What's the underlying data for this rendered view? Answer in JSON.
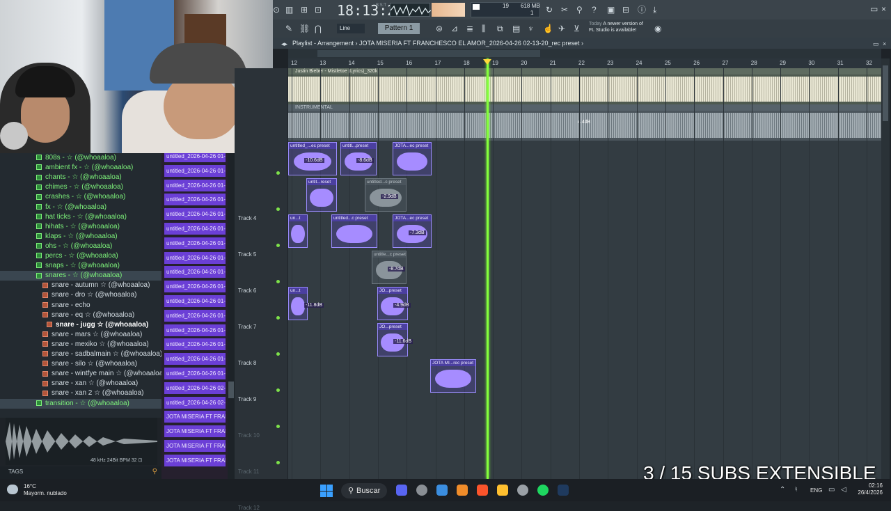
{
  "webcam": {
    "label": "webcam overlay"
  },
  "browser": {
    "items": [
      {
        "label": "808s - ☆ (@whoaaloa)",
        "type": "folder"
      },
      {
        "label": "ambient fx - ☆ (@whoaaloa)",
        "type": "folder"
      },
      {
        "label": "chants - ☆ (@whoaaloa)",
        "type": "folder"
      },
      {
        "label": "chimes - ☆ (@whoaaloa)",
        "type": "folder"
      },
      {
        "label": "crashes - ☆ (@whoaaloa)",
        "type": "folder"
      },
      {
        "label": "fx - ☆ (@whoaaloa)",
        "type": "folder"
      },
      {
        "label": "hat ticks - ☆ (@whoaaloa)",
        "type": "folder"
      },
      {
        "label": "hihats - ☆ (@whoaaloa)",
        "type": "folder"
      },
      {
        "label": "klaps - ☆ (@whoaaloa)",
        "type": "folder"
      },
      {
        "label": "ohs - ☆ (@whoaaloa)",
        "type": "folder"
      },
      {
        "label": "percs - ☆ (@whoaaloa)",
        "type": "folder"
      },
      {
        "label": "snaps - ☆ (@whoaaloa)",
        "type": "folder"
      },
      {
        "label": "snares - ☆ (@whoaaloa)",
        "type": "folder",
        "selected": true
      },
      {
        "label": "snare - autumn ☆ (@whoaaloa)",
        "type": "file"
      },
      {
        "label": "snare - dro ☆ (@whoaaloa)",
        "type": "file"
      },
      {
        "label": "snare - echo",
        "type": "file"
      },
      {
        "label": "snare - eq ☆ (@whoaaloa)",
        "type": "file"
      },
      {
        "label": "snare - jugg ☆ (@whoaaloa)",
        "type": "file",
        "highlight": true
      },
      {
        "label": "snare - mars ☆ (@whoaaloa)",
        "type": "file"
      },
      {
        "label": "snare - mexiko ☆ (@whoaaloa)",
        "type": "file"
      },
      {
        "label": "snare - sadbalmain ☆ (@whoaaloa)",
        "type": "file"
      },
      {
        "label": "snare - silo ☆ (@whoaaloa)",
        "type": "file"
      },
      {
        "label": "snare - wintfye main ☆ (@whoaaloa)",
        "type": "file"
      },
      {
        "label": "snare - xan ☆ (@whoaaloa)",
        "type": "file"
      },
      {
        "label": "snare - xan 2 ☆ (@whoaaloa)",
        "type": "file"
      },
      {
        "label": "transition - ☆ (@whoaaloa)",
        "type": "folder",
        "selected": true
      }
    ],
    "preview_info": "48 kHz 24Bit BPM 32 ⊡",
    "tags_label": "TAGS"
  },
  "patterns": [
    "untitled_2026-04-26 01-...",
    "untitled_2026-04-26 01-...",
    "untitled_2026-04-26 01-...",
    "untitled_2026-04-26 01-...",
    "untitled_2026-04-26 01-...",
    "untitled_2026-04-26 01-...",
    "untitled_2026-04-26 01-...",
    "untitled_2026-04-26 01-...",
    "untitled_2026-04-26 01-...",
    "untitled_2026-04-26 01-...",
    "untitled_2026-04-26 01-...",
    "untitled_2026-04-26 01-...",
    "untitled_2026-04-26 01-...",
    "untitled_2026-04-26 01-...",
    "untitled_2026-04-26 01-...",
    "untitled_2026-04-26 01-...",
    "untitled_2026-04-26 02-...",
    "untitled_2026-04-26 02-...",
    "JOTA MISERIA FT FRANCH...",
    "JOTA MISERIA FT FRANCH...",
    "JOTA MISERIA FT FRANCH...",
    "JOTA MISERIA FT FRANCH..."
  ],
  "toolbar": {
    "time": "18:13:21",
    "time_sub": "B:S:T",
    "cpu_a": "19",
    "cpu_b": "618 MB",
    "cpu_c": "1",
    "snap": "Line",
    "pattern": "Pattern 1",
    "notice_date": "Today",
    "notice_text": "A newer version of",
    "notice_text2": "FL Studio is available!"
  },
  "playlist": {
    "title": "Playlist - Arrangement  ›  JOTA MISERIA FT FRANCHESCO EL AMOR_2026-04-26 02-13-20_rec preset  ›",
    "ruler": [
      "12",
      "13",
      "14",
      "15",
      "16",
      "17",
      "18",
      "19",
      "20",
      "21",
      "22",
      "23",
      "24",
      "25",
      "26",
      "27",
      "28",
      "29",
      "30",
      "31",
      "32"
    ],
    "audio1_label": "Justin Bieber - Mistletoe (Lyrics)_320k",
    "audio2_label": "INSTRUMENTAL",
    "audio2_db": "4.4dB",
    "tracks": [
      {
        "name": "",
        "dim": false
      },
      {
        "name": "Track 4",
        "dim": false
      },
      {
        "name": "Track 5",
        "dim": false
      },
      {
        "name": "Track 6",
        "dim": false
      },
      {
        "name": "Track 7",
        "dim": false
      },
      {
        "name": "Track 8",
        "dim": false
      },
      {
        "name": "Track 9",
        "dim": false
      },
      {
        "name": "Track 10",
        "dim": true
      },
      {
        "name": "Track 11",
        "dim": true
      },
      {
        "name": "Track 12",
        "dim": true
      }
    ],
    "clips": [
      {
        "row": 0,
        "label": "untitled_...ec preset",
        "db": "-10.6dB",
        "muted": false
      },
      {
        "row": 0,
        "label": "untitl...preset",
        "db": "-8.6dB",
        "muted": false
      },
      {
        "row": 0,
        "label": "JOTA...ec preset",
        "db": "",
        "muted": false
      },
      {
        "row": 1,
        "label": "untit...reset",
        "db": "",
        "muted": false
      },
      {
        "row": 1,
        "label": "untitled...c preset",
        "db": "-2.9dB",
        "muted": true
      },
      {
        "row": 2,
        "label": "un...t",
        "db": "",
        "muted": false
      },
      {
        "row": 2,
        "label": "untitled...c preset",
        "db": "",
        "muted": false
      },
      {
        "row": 2,
        "label": "JOTA...ec preset",
        "db": "-7.3dB",
        "muted": false
      },
      {
        "row": 3,
        "label": "untitle...c preset",
        "db": "-8.7dB",
        "muted": true
      },
      {
        "row": 4,
        "label": "un...t",
        "db": "-11.8dB",
        "muted": false
      },
      {
        "row": 4,
        "label": "JO...preset",
        "db": "-4.9dB",
        "muted": false
      },
      {
        "row": 5,
        "label": "JO...preset",
        "db": "-11.6dB",
        "muted": false
      },
      {
        "row": 6,
        "label": "JOTA MI...rec preset",
        "db": "",
        "muted": false
      }
    ]
  },
  "overlay": {
    "subs_text": "3 / 15 SUBS EXTENSIBLE"
  },
  "taskbar": {
    "weather_temp": "16°C",
    "weather_desc": "Mayorm. nublado",
    "search": "Buscar",
    "lang": "ENG",
    "time": "02:16",
    "date": "26/4/2026"
  },
  "colors": {
    "playhead": "#84ff3c",
    "pattern_clip": "#6b3fd6",
    "folder_green": "#7df27a"
  }
}
